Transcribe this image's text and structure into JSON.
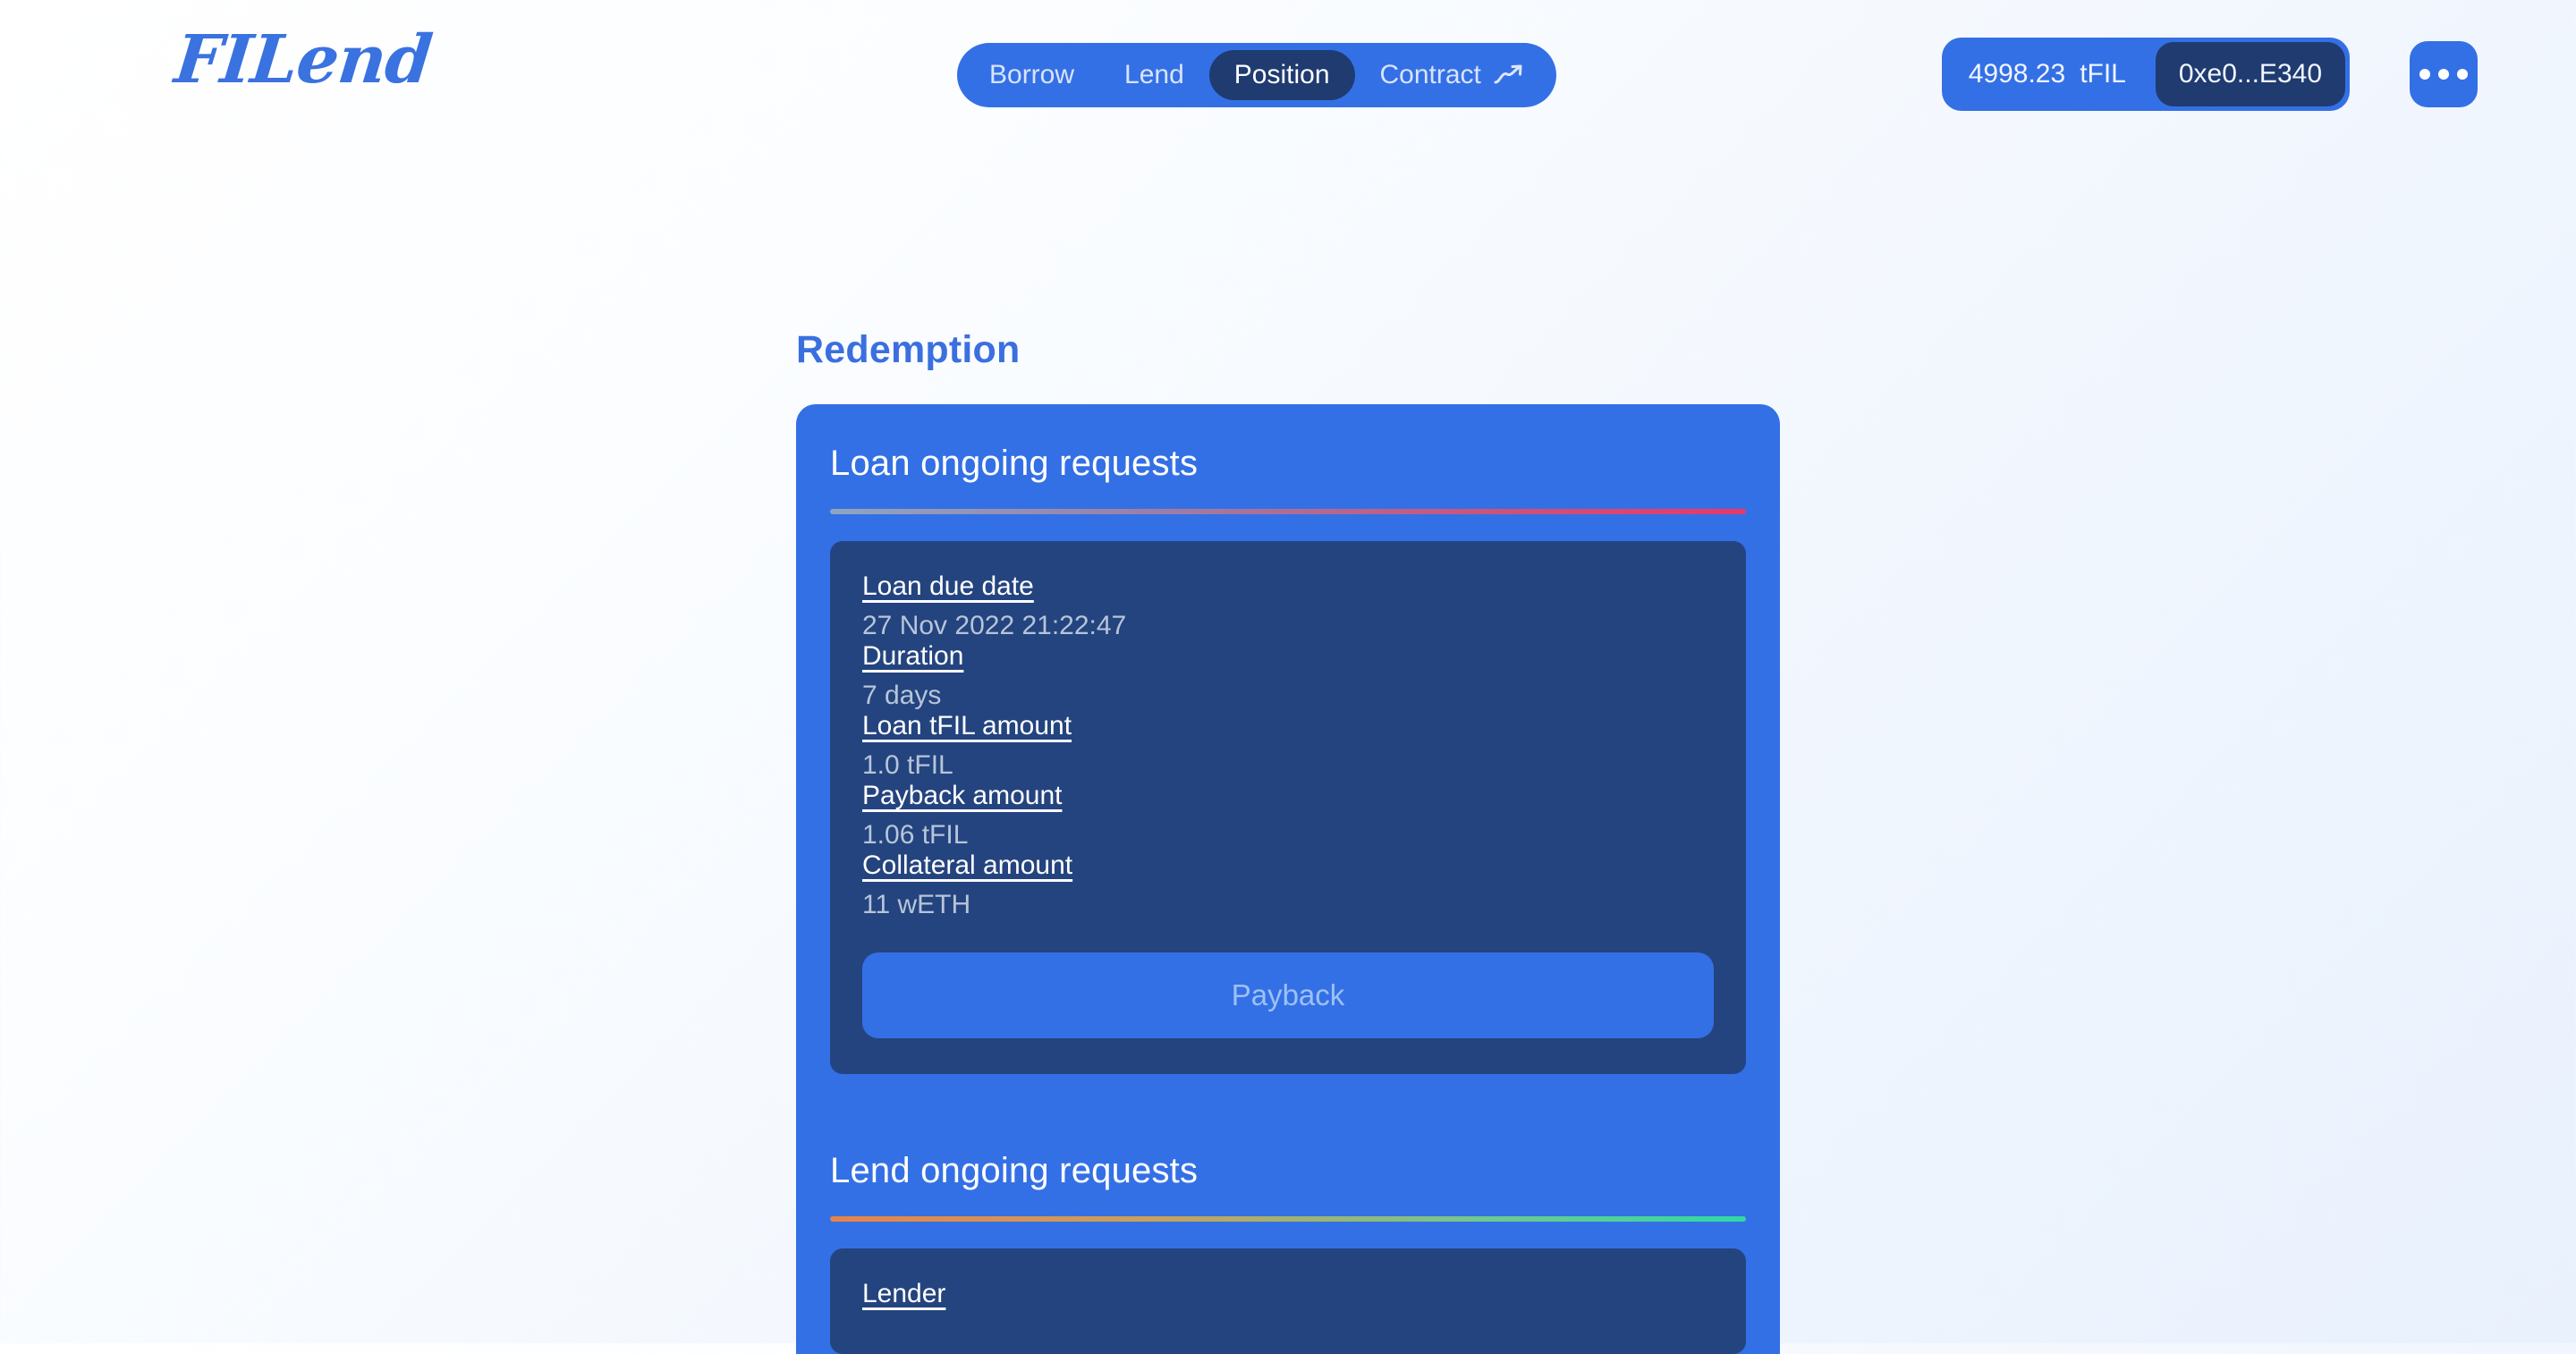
{
  "brand": {
    "logo_text": "FILend"
  },
  "nav": {
    "items": [
      {
        "label": "Borrow",
        "active": false,
        "icon": null
      },
      {
        "label": "Lend",
        "active": false,
        "icon": null
      },
      {
        "label": "Position",
        "active": true,
        "icon": null
      },
      {
        "label": "Contract",
        "active": false,
        "icon": "trending-up-icon"
      }
    ]
  },
  "wallet": {
    "balance_amount": "4998.23",
    "balance_symbol": "tFIL",
    "address": "0xe0...E340",
    "more_label": "•••"
  },
  "main": {
    "page_title": "Redemption",
    "loan_section": {
      "title": "Loan ongoing requests",
      "rows": [
        {
          "label": "Loan due date",
          "value": "27 Nov 2022 21:22:47"
        },
        {
          "label": "Duration",
          "value": "7 days"
        },
        {
          "label": "Loan tFIL amount",
          "value": "1.0 tFIL"
        },
        {
          "label": "Payback amount",
          "value": "1.06 tFIL"
        },
        {
          "label": "Collateral amount",
          "value": "11 wETH"
        }
      ],
      "action_label": "Payback"
    },
    "lend_section": {
      "title": "Lend ongoing requests",
      "rows": [
        {
          "label": "Lender",
          "value": ""
        }
      ]
    }
  },
  "colors": {
    "brand_blue": "#3470e5",
    "active_navy": "#1f3b70",
    "panel_navy": "#24447f",
    "title_blue": "#3b6fe0",
    "value_gray": "#b7c5da",
    "disabled_text": "#9dc0f5"
  }
}
